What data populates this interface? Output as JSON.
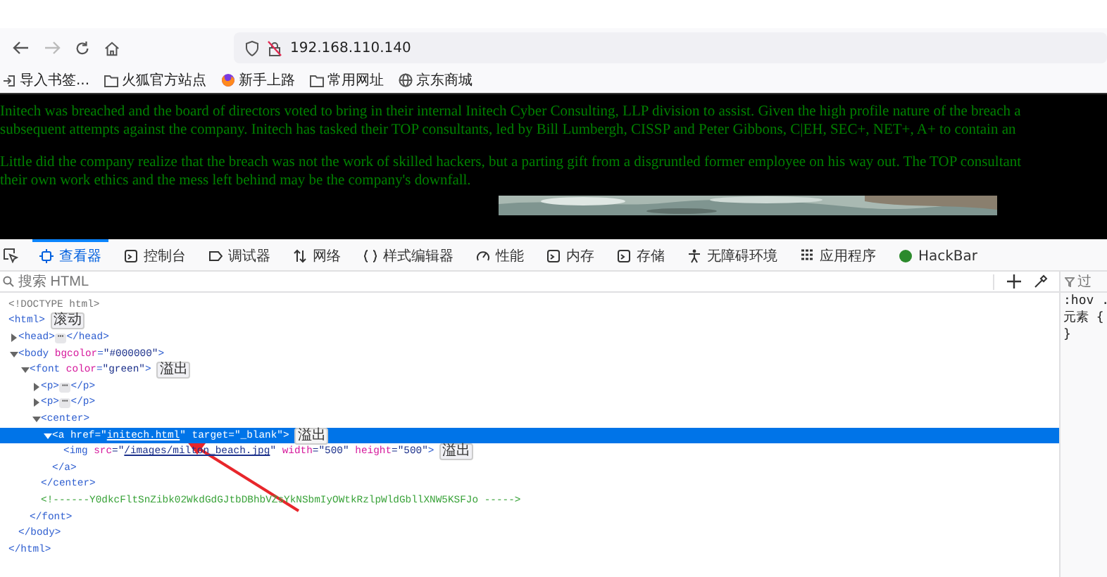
{
  "toolbar": {
    "back_disabled": false,
    "forward_disabled": true,
    "url": "192.168.110.140"
  },
  "bookmarks": [
    "导入书签...",
    "火狐官方站点",
    "新手上路",
    "常用网址",
    "京东商城"
  ],
  "page": {
    "paragraphs": [
      [
        "Initech was breached and the board of directors voted to bring in their internal Initech Cyber Consulting, LLP division to assist. Given the high profile nature of the breach a",
        "subsequent attempts against the company. Initech has tasked their TOP consultants, led by Bill Lumbergh, CISSP and Peter Gibbons, C|EH, SEC+, NET+, A+ to contain an"
      ],
      [
        "Little did the company realize that the breach was not the work of skilled hackers, but a parting gift from a disgruntled former employee on his way out. The TOP consultant",
        "their own work ethics and the mess left behind may be the company's downfall."
      ]
    ],
    "image": {
      "kind": "picture"
    }
  },
  "devtools": {
    "tabs": [
      {
        "label": "查看器",
        "selected": true
      },
      {
        "label": "控制台",
        "selected": false
      },
      {
        "label": "调试器",
        "selected": false
      },
      {
        "label": "网络",
        "selected": false
      },
      {
        "label": "样式编辑器",
        "selected": false
      },
      {
        "label": "性能",
        "selected": false
      },
      {
        "label": "内存",
        "selected": false
      },
      {
        "label": "存储",
        "selected": false
      },
      {
        "label": "无障碍环境",
        "selected": false
      },
      {
        "label": "应用程序",
        "selected": false
      },
      {
        "label": "HackBar",
        "selected": false
      }
    ],
    "search": {
      "placeholder": "搜索 HTML"
    },
    "tree": [
      {
        "selected": false,
        "tokens": [
          {
            "text": "<!DOCTYPE html>",
            "kind": "doctype"
          }
        ]
      },
      {
        "selected": false,
        "tokens": [
          {
            "text": "<html>",
            "kind": "tag"
          }
        ],
        "badge": "滚动",
        "close": [
          {
            "text": "</html>",
            "kind": "tag"
          }
        ],
        "children": [
          {
            "selected": false,
            "expanded": false,
            "tokens": [
              {
                "text": "<head>",
                "kind": "tag"
              },
              {
                "text": "⋯",
                "kind": "ellipsis"
              },
              {
                "text": "</head>",
                "kind": "tag"
              }
            ]
          },
          {
            "selected": false,
            "expanded": true,
            "tokens": [
              {
                "text": "<body ",
                "kind": "tag"
              },
              {
                "text": "bgcolor",
                "kind": "attr"
              },
              {
                "text": "=",
                "kind": "tag"
              },
              {
                "text": "\"#000000\"",
                "kind": "value"
              },
              {
                "text": ">",
                "kind": "tag"
              }
            ],
            "close": [
              {
                "text": "</body>",
                "kind": "tag"
              }
            ],
            "children": [
              {
                "selected": false,
                "expanded": true,
                "tokens": [
                  {
                    "text": "<font ",
                    "kind": "tag"
                  },
                  {
                    "text": "color",
                    "kind": "attr"
                  },
                  {
                    "text": "=",
                    "kind": "tag"
                  },
                  {
                    "text": "\"green\"",
                    "kind": "value"
                  },
                  {
                    "text": ">",
                    "kind": "tag"
                  }
                ],
                "badge": "溢出",
                "close": [
                  {
                    "text": "</font>",
                    "kind": "tag"
                  }
                ],
                "children": [
                  {
                    "selected": false,
                    "expanded": false,
                    "tokens": [
                      {
                        "text": "<p>",
                        "kind": "tag"
                      },
                      {
                        "text": "⋯",
                        "kind": "ellipsis"
                      },
                      {
                        "text": "</p>",
                        "kind": "tag"
                      }
                    ]
                  },
                  {
                    "selected": false,
                    "expanded": false,
                    "tokens": [
                      {
                        "text": "<p>",
                        "kind": "tag"
                      },
                      {
                        "text": "⋯",
                        "kind": "ellipsis"
                      },
                      {
                        "text": "</p>",
                        "kind": "tag"
                      }
                    ]
                  },
                  {
                    "selected": false,
                    "expanded": true,
                    "tokens": [
                      {
                        "text": "<center>",
                        "kind": "tag"
                      }
                    ],
                    "close": [
                      {
                        "text": "</center>",
                        "kind": "tag"
                      }
                    ],
                    "children": [
                      {
                        "selected": true,
                        "expanded": true,
                        "tokens": [
                          {
                            "text": "<a ",
                            "kind": "tag"
                          },
                          {
                            "text": "href",
                            "kind": "attr"
                          },
                          {
                            "text": "=\"",
                            "kind": "value"
                          },
                          {
                            "text": "initech.html",
                            "kind": "link"
                          },
                          {
                            "text": "\"",
                            "kind": "value"
                          },
                          {
                            "text": " target",
                            "kind": "attr"
                          },
                          {
                            "text": "=\"_blank\"",
                            "kind": "value"
                          },
                          {
                            "text": ">",
                            "kind": "tag"
                          }
                        ],
                        "badge": "溢出",
                        "close": [
                          {
                            "text": "</a>",
                            "kind": "tag"
                          }
                        ],
                        "children": [
                          {
                            "selected": false,
                            "tokens": [
                              {
                                "text": "<img ",
                                "kind": "tag"
                              },
                              {
                                "text": "src",
                                "kind": "attr"
                              },
                              {
                                "text": "=\"",
                                "kind": "value"
                              },
                              {
                                "text": "/images/milton_beach.jpg",
                                "kind": "link"
                              },
                              {
                                "text": "\"",
                                "kind": "value"
                              },
                              {
                                "text": " width",
                                "kind": "attr"
                              },
                              {
                                "text": "=\"500\"",
                                "kind": "value"
                              },
                              {
                                "text": " height",
                                "kind": "attr"
                              },
                              {
                                "text": "=\"500\"",
                                "kind": "value"
                              },
                              {
                                "text": ">",
                                "kind": "tag"
                              }
                            ],
                            "badge": "溢出"
                          }
                        ]
                      }
                    ]
                  },
                  {
                    "selected": false,
                    "tokens": [
                      {
                        "text": "<!------Y0dkcFltSnZibk02WkdGdGJtbDBhbVZsYkNSbmIyOWtkRzlpWldGbllXNW5KSFJo ----->",
                        "kind": "comment"
                      }
                    ]
                  }
                ]
              }
            ]
          }
        ]
      }
    ],
    "sidebar": {
      "filter_placeholder": "过",
      "lines": [
        ":hov .",
        "元素 {",
        "}"
      ]
    }
  }
}
